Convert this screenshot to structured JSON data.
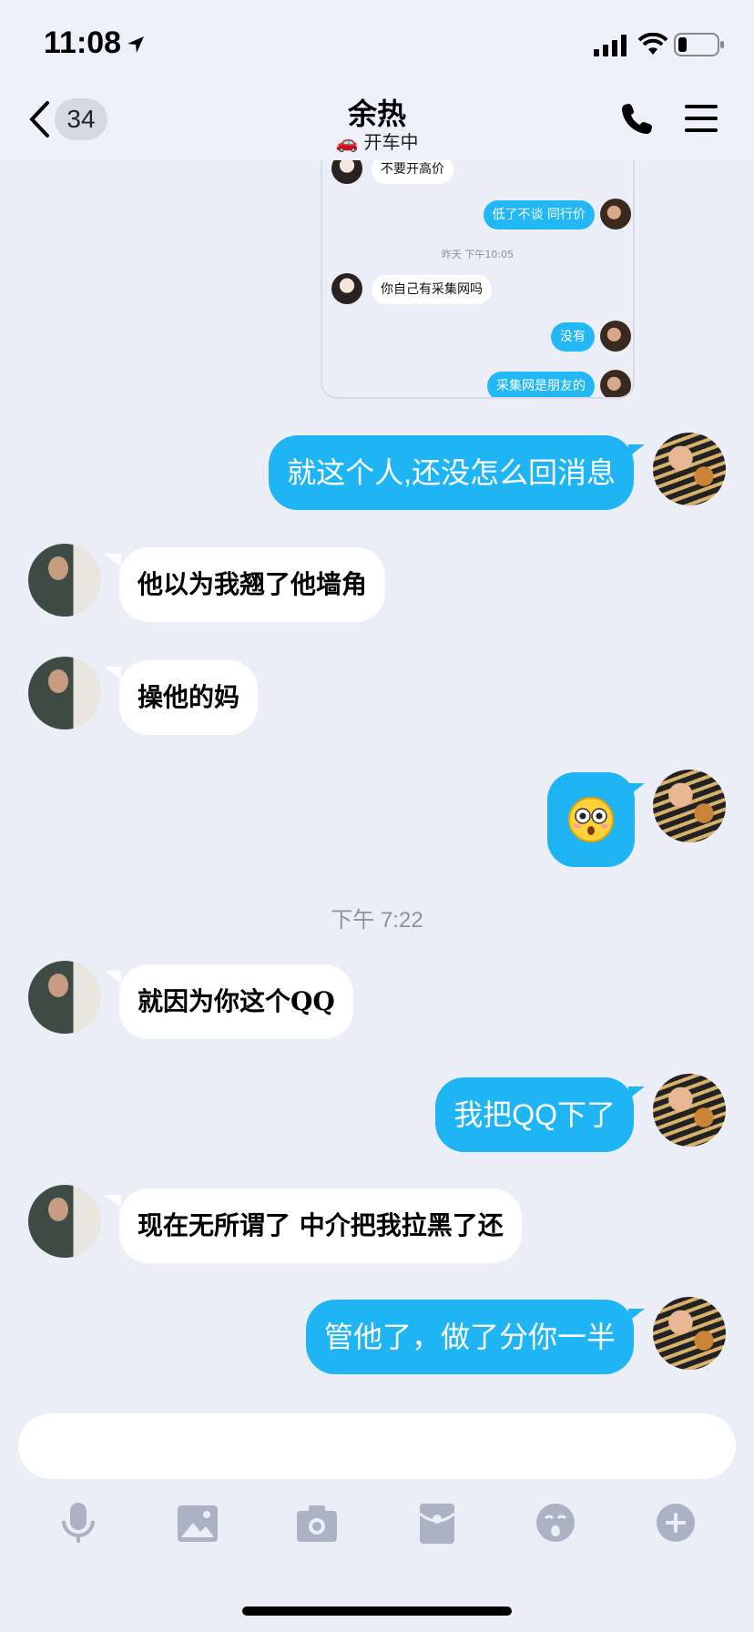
{
  "status_bar": {
    "time": "11:08"
  },
  "header": {
    "unread_count": "34",
    "contact_name": "余热",
    "contact_status": "开车中",
    "status_emoji": "🚗"
  },
  "forwarded_screenshot": {
    "messages": [
      {
        "from": "friend",
        "text": "不要开高价"
      },
      {
        "from": "self",
        "text": "低了不谈  同行价"
      },
      {
        "type": "time",
        "text": "昨天 下午10:05"
      },
      {
        "from": "friend",
        "text": "你自己有采集网吗"
      },
      {
        "from": "self",
        "text": "没有"
      },
      {
        "from": "self",
        "text": "采集网是朋友的"
      }
    ]
  },
  "messages": [
    {
      "from": "self",
      "text": "就这个人,还没怎么回消息"
    },
    {
      "from": "friend",
      "text": "他以为我翘了他墙角"
    },
    {
      "from": "friend",
      "text": "操他的妈"
    },
    {
      "from": "self",
      "type": "emoji",
      "emoji": "😳"
    },
    {
      "type": "time",
      "text": "下午 7:22"
    },
    {
      "from": "friend",
      "text": "就因为你这个QQ"
    },
    {
      "from": "self",
      "text": "我把QQ下了"
    },
    {
      "from": "friend",
      "text": "现在无所谓了 中介把我拉黑了还"
    },
    {
      "from": "self",
      "text": "管他了，做了分你一半"
    }
  ],
  "input": {
    "value": "",
    "placeholder": ""
  },
  "toolbar": [
    "microphone-icon",
    "image-icon",
    "camera-icon",
    "red-packet-icon",
    "emoji-icon",
    "plus-icon"
  ],
  "colors": {
    "bubble_out": "#1fb5f5",
    "bubble_in": "#ffffff",
    "background": "#ebeef6"
  }
}
